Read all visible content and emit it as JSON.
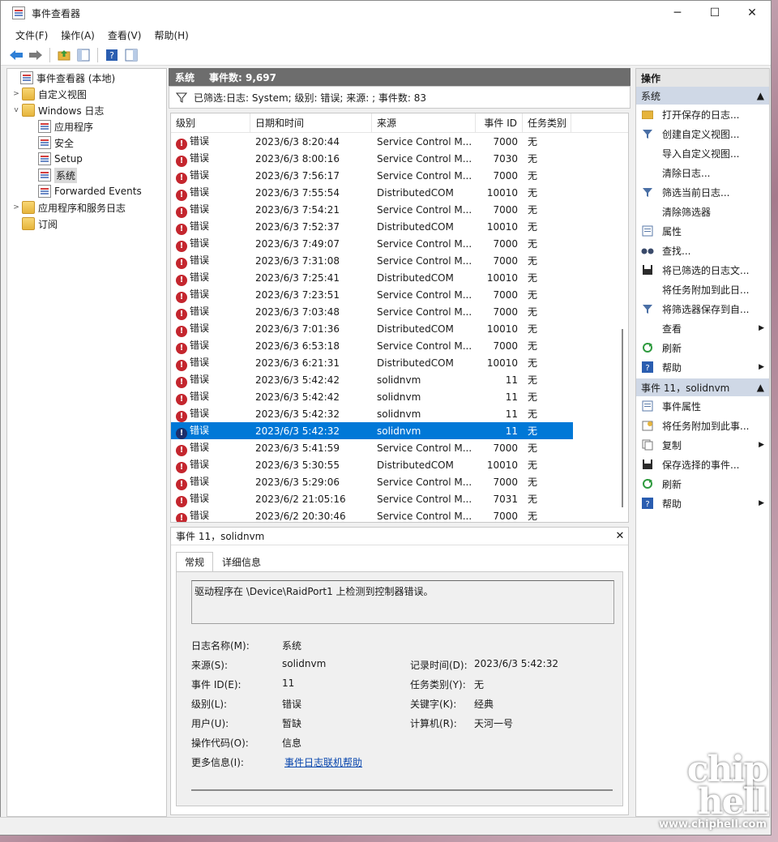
{
  "window": {
    "title": "事件查看器",
    "min": "─",
    "max": "☐",
    "close": "✕"
  },
  "menu": [
    "文件(F)",
    "操作(A)",
    "查看(V)",
    "帮助(H)"
  ],
  "tree": {
    "root": "事件查看器 (本地)",
    "custom_views": "自定义视图",
    "windows_logs": "Windows 日志",
    "app": "应用程序",
    "security": "安全",
    "setup": "Setup",
    "system": "系统",
    "forwarded": "Forwarded Events",
    "app_service_logs": "应用程序和服务日志",
    "subscriptions": "订阅"
  },
  "center": {
    "title": "系统",
    "count": "事件数: 9,697",
    "filter_text": "已筛选:日志: System; 级别: 错误; 来源: ; 事件数: 83"
  },
  "columns": [
    "级别",
    "日期和时间",
    "来源",
    "事件 ID",
    "任务类别"
  ],
  "rows": [
    {
      "level": "错误",
      "date": "2023/6/3 8:20:44",
      "source": "Service Control M...",
      "id": "7000",
      "cat": "无"
    },
    {
      "level": "错误",
      "date": "2023/6/3 8:00:16",
      "source": "Service Control M...",
      "id": "7030",
      "cat": "无"
    },
    {
      "level": "错误",
      "date": "2023/6/3 7:56:17",
      "source": "Service Control M...",
      "id": "7000",
      "cat": "无"
    },
    {
      "level": "错误",
      "date": "2023/6/3 7:55:54",
      "source": "DistributedCOM",
      "id": "10010",
      "cat": "无"
    },
    {
      "level": "错误",
      "date": "2023/6/3 7:54:21",
      "source": "Service Control M...",
      "id": "7000",
      "cat": "无"
    },
    {
      "level": "错误",
      "date": "2023/6/3 7:52:37",
      "source": "DistributedCOM",
      "id": "10010",
      "cat": "无"
    },
    {
      "level": "错误",
      "date": "2023/6/3 7:49:07",
      "source": "Service Control M...",
      "id": "7000",
      "cat": "无"
    },
    {
      "level": "错误",
      "date": "2023/6/3 7:31:08",
      "source": "Service Control M...",
      "id": "7000",
      "cat": "无"
    },
    {
      "level": "错误",
      "date": "2023/6/3 7:25:41",
      "source": "DistributedCOM",
      "id": "10010",
      "cat": "无"
    },
    {
      "level": "错误",
      "date": "2023/6/3 7:23:51",
      "source": "Service Control M...",
      "id": "7000",
      "cat": "无"
    },
    {
      "level": "错误",
      "date": "2023/6/3 7:03:48",
      "source": "Service Control M...",
      "id": "7000",
      "cat": "无"
    },
    {
      "level": "错误",
      "date": "2023/6/3 7:01:36",
      "source": "DistributedCOM",
      "id": "10010",
      "cat": "无"
    },
    {
      "level": "错误",
      "date": "2023/6/3 6:53:18",
      "source": "Service Control M...",
      "id": "7000",
      "cat": "无"
    },
    {
      "level": "错误",
      "date": "2023/6/3 6:21:31",
      "source": "DistributedCOM",
      "id": "10010",
      "cat": "无"
    },
    {
      "level": "错误",
      "date": "2023/6/3 5:42:42",
      "source": "solidnvm",
      "id": "11",
      "cat": "无"
    },
    {
      "level": "错误",
      "date": "2023/6/3 5:42:42",
      "source": "solidnvm",
      "id": "11",
      "cat": "无"
    },
    {
      "level": "错误",
      "date": "2023/6/3 5:42:32",
      "source": "solidnvm",
      "id": "11",
      "cat": "无"
    },
    {
      "level": "错误",
      "date": "2023/6/3 5:42:32",
      "source": "solidnvm",
      "id": "11",
      "cat": "无",
      "selected": true
    },
    {
      "level": "错误",
      "date": "2023/6/3 5:41:59",
      "source": "Service Control M...",
      "id": "7000",
      "cat": "无"
    },
    {
      "level": "错误",
      "date": "2023/6/3 5:30:55",
      "source": "DistributedCOM",
      "id": "10010",
      "cat": "无"
    },
    {
      "level": "错误",
      "date": "2023/6/3 5:29:06",
      "source": "Service Control M...",
      "id": "7000",
      "cat": "无"
    },
    {
      "level": "错误",
      "date": "2023/6/2 21:05:16",
      "source": "Service Control M...",
      "id": "7031",
      "cat": "无"
    },
    {
      "level": "错误",
      "date": "2023/6/2 20:30:46",
      "source": "Service Control M...",
      "id": "7000",
      "cat": "无"
    }
  ],
  "detail": {
    "title": "事件 11，solidnvm",
    "tabs": [
      "常规",
      "详细信息"
    ],
    "description": "驱动程序在 \\Device\\RaidPort1 上检测到控制器错误。",
    "labels": {
      "log_name": "日志名称(M):",
      "source": "来源(S):",
      "event_id": "事件 ID(E):",
      "level": "级别(L):",
      "user": "用户(U):",
      "opcode": "操作代码(O):",
      "more_info": "更多信息(I):",
      "logged": "记录时间(D):",
      "task_category": "任务类别(Y):",
      "keywords": "关键字(K):",
      "computer": "计算机(R):"
    },
    "values": {
      "log_name": "系统",
      "source": "solidnvm",
      "event_id": "11",
      "level": "错误",
      "user": "暂缺",
      "opcode": "信息",
      "more_info": "事件日志联机帮助",
      "logged": "2023/6/3 5:42:32",
      "task_category": "无",
      "keywords": "经典",
      "computer": "天河一号"
    }
  },
  "actions": {
    "header": "操作",
    "section1": "系统",
    "items1": [
      "打开保存的日志...",
      "创建自定义视图...",
      "导入自定义视图...",
      "清除日志...",
      "筛选当前日志...",
      "清除筛选器",
      "属性",
      "查找...",
      "将已筛选的日志文...",
      "将任务附加到此日...",
      "将筛选器保存到自...",
      "查看",
      "刷新",
      "帮助"
    ],
    "section2": "事件 11，solidnvm",
    "items2": [
      "事件属性",
      "将任务附加到此事...",
      "复制",
      "保存选择的事件...",
      "刷新",
      "帮助"
    ]
  },
  "watermark": {
    "logo": "chip hell",
    "site": "www.chiphell.com"
  },
  "colors": {
    "selection": "#0078d7",
    "error": "#c4262e",
    "section": "#cfd8e6"
  }
}
